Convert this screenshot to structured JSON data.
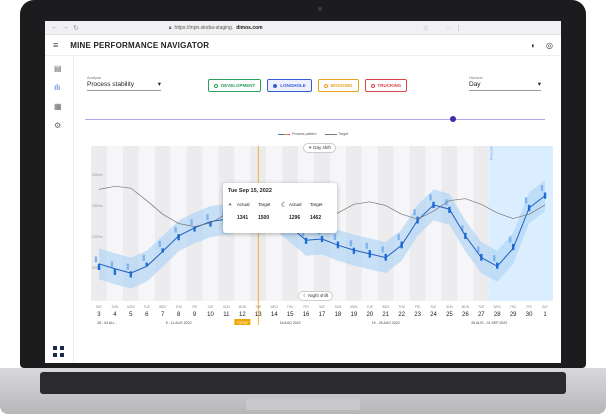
{
  "browser": {
    "url_prefix": "https://mpn.skoba-staging.",
    "url_domain": "dimos.com"
  },
  "app": {
    "title": "MINE PERFORMANCE NAVIGATOR"
  },
  "analyse": {
    "label": "Analyse",
    "value": "Process stability"
  },
  "horizon": {
    "label": "Horizon",
    "value": "Day"
  },
  "chips": [
    {
      "label": "DEVELOPMENT",
      "color": "#2e9e5b",
      "selected": false
    },
    {
      "label": "LONGHOLE",
      "color": "#3a5bd9",
      "selected": true
    },
    {
      "label": "BOGGING",
      "color": "#e8a21c",
      "selected": false
    },
    {
      "label": "TRUCKING",
      "color": "#d9434a",
      "selected": false
    }
  ],
  "legend": {
    "process_pattern": "Process pattern",
    "target": "Target"
  },
  "shift_labels": {
    "day": "Day shift",
    "night": "Night shift"
  },
  "forecast_label": "Forecast",
  "tooltip": {
    "date": "Tue Sep 15, 2022",
    "actual_label": "Actual",
    "target_label": "Target",
    "day_actual": "1341",
    "day_target": "1500",
    "night_actual": "1296",
    "night_target": "1462"
  },
  "chart_data": {
    "type": "line",
    "y_ticks": [
      "2000m",
      "1500m",
      "1000m",
      "500m"
    ],
    "days": [
      {
        "dow": "SAT",
        "num": "3"
      },
      {
        "dow": "SUN",
        "num": "4"
      },
      {
        "dow": "MON",
        "num": "5"
      },
      {
        "dow": "TUE",
        "num": "6"
      },
      {
        "dow": "WED",
        "num": "7"
      },
      {
        "dow": "THU",
        "num": "8"
      },
      {
        "dow": "FRI",
        "num": "9"
      },
      {
        "dow": "SAT",
        "num": "10"
      },
      {
        "dow": "SUN",
        "num": "11"
      },
      {
        "dow": "MON",
        "num": "12"
      },
      {
        "dow": "TUE",
        "num": "13"
      },
      {
        "dow": "WED",
        "num": "14"
      },
      {
        "dow": "THU",
        "num": "15"
      },
      {
        "dow": "FRI",
        "num": "16"
      },
      {
        "dow": "SAT",
        "num": "17"
      },
      {
        "dow": "SUN",
        "num": "18"
      },
      {
        "dow": "MON",
        "num": "19"
      },
      {
        "dow": "TUE",
        "num": "20"
      },
      {
        "dow": "WED",
        "num": "21"
      },
      {
        "dow": "THU",
        "num": "22"
      },
      {
        "dow": "FRI",
        "num": "23"
      },
      {
        "dow": "SAT",
        "num": "24"
      },
      {
        "dow": "SUN",
        "num": "25"
      },
      {
        "dow": "MON",
        "num": "26"
      },
      {
        "dow": "TUE",
        "num": "27"
      },
      {
        "dow": "WED",
        "num": "28"
      },
      {
        "dow": "THU",
        "num": "29"
      },
      {
        "dow": "FRI",
        "num": "30"
      },
      {
        "dow": "SAT",
        "num": "1"
      }
    ],
    "weeks": [
      {
        "label": "28 - 04 AU...",
        "span": 2
      },
      {
        "label": "5 - 11 AUG 2022",
        "span": 7
      },
      {
        "label": "TODAY",
        "span": 1
      },
      {
        "label": "16 AUG 2022",
        "span": 5
      },
      {
        "label": "19 - 25 AUG 2022",
        "span": 7
      },
      {
        "label": "26 AUG - 01 SEP 2022",
        "span": 6
      },
      {
        "label": "02 - 08 SEP 2022",
        "span": 4
      }
    ],
    "ylim": [
      0,
      2500
    ],
    "today_index": 10.5,
    "series": [
      {
        "name": "Process pattern",
        "values": [
          600,
          520,
          450,
          560,
          800,
          1050,
          1180,
          1280,
          1320,
          1380,
          1450,
          1400,
          1200,
          980,
          1000,
          900,
          820,
          760,
          700,
          900,
          1300,
          1550,
          1480,
          1050,
          700,
          560,
          850,
          1500,
          1700
        ]
      },
      {
        "name": "Target",
        "values": [
          1800,
          1850,
          1820,
          1620,
          1400,
          1250,
          1200,
          1260,
          1400,
          1560,
          1620,
          1580,
          1460,
          1320,
          1280,
          1420,
          1560,
          1600,
          1540,
          1400,
          1320,
          1450,
          1620,
          1650,
          1560,
          1420,
          1330,
          1400,
          1550
        ]
      }
    ],
    "bars": [
      [
        500,
        600
      ],
      [
        420,
        520
      ],
      [
        380,
        480
      ],
      [
        560,
        620
      ],
      [
        780,
        850
      ],
      [
        980,
        1080
      ],
      [
        1120,
        1200
      ],
      [
        1200,
        1280
      ],
      [
        1250,
        1330
      ],
      [
        1300,
        1400
      ],
      [
        1400,
        1480
      ],
      [
        1350,
        1450
      ],
      [
        1100,
        1250
      ],
      [
        920,
        1020
      ],
      [
        950,
        1050
      ],
      [
        850,
        960
      ],
      [
        760,
        860
      ],
      [
        700,
        820
      ],
      [
        650,
        760
      ],
      [
        850,
        960
      ],
      [
        1250,
        1360
      ],
      [
        1500,
        1600
      ],
      [
        1420,
        1520
      ],
      [
        1000,
        1100
      ],
      [
        650,
        760
      ],
      [
        520,
        620
      ],
      [
        820,
        920
      ],
      [
        1450,
        1550
      ],
      [
        1650,
        1750
      ]
    ]
  }
}
